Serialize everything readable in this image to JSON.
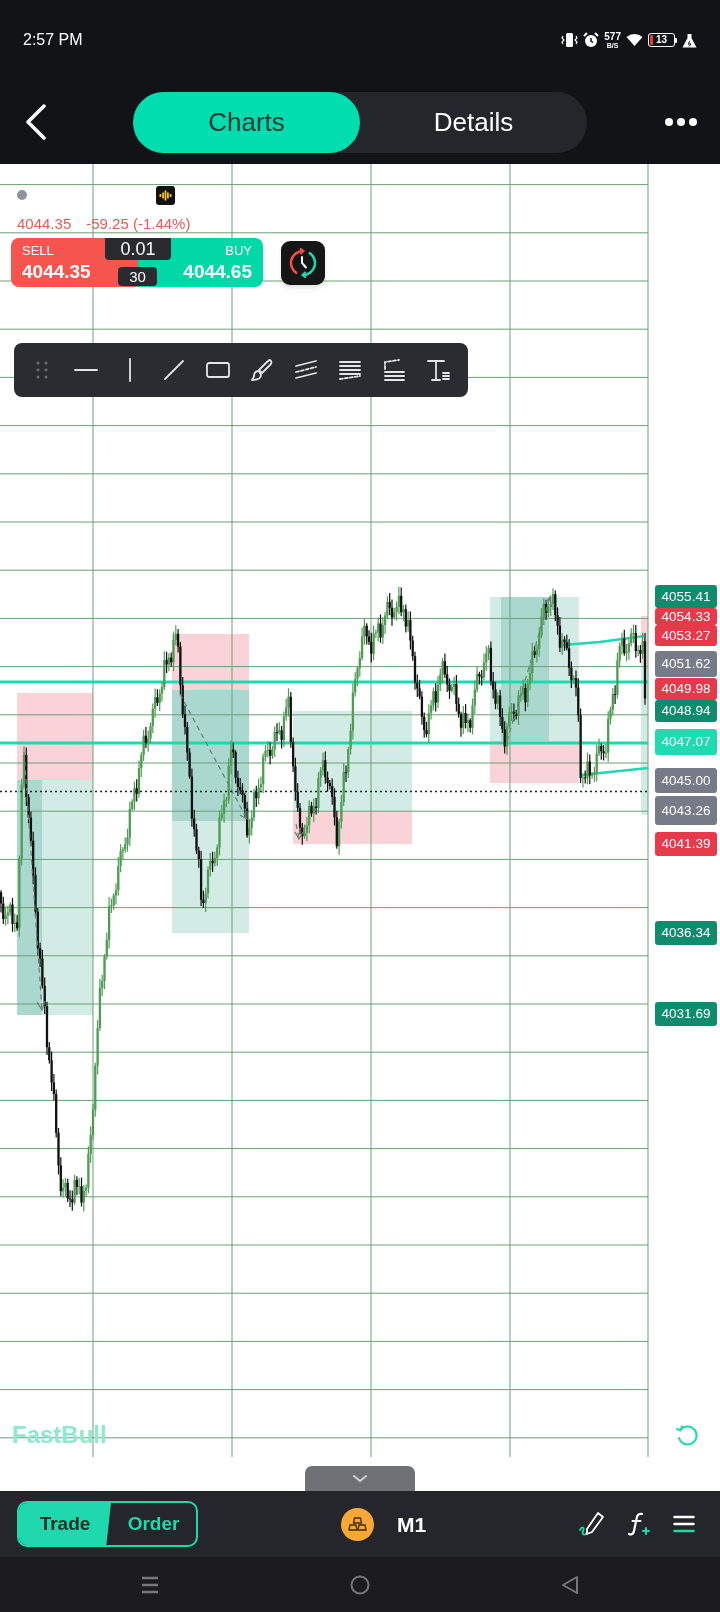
{
  "status_bar": {
    "time": "2:57 PM",
    "net_speed": "577",
    "net_speed_unit": "B/S",
    "battery": "13"
  },
  "header": {
    "tabs": [
      {
        "label": "Charts",
        "selected": true
      },
      {
        "label": "Details",
        "selected": false
      }
    ]
  },
  "quote": {
    "price": "4044.35",
    "change": "-59.25 (-1.44%)"
  },
  "trade_panel": {
    "sell": {
      "label": "SELL",
      "price": "4044.35"
    },
    "lot": "0.01",
    "spread": "30",
    "buy": {
      "label": "BUY",
      "price": "4044.65"
    }
  },
  "price_labels": [
    {
      "text": "4055.41",
      "color": "#0f8c6d"
    },
    {
      "text": "4054.33",
      "color": "#e63a4b"
    },
    {
      "text": "4053.27",
      "color": "#e63a4b"
    },
    {
      "text": "4051.62",
      "color": "#767b87"
    },
    {
      "text": "4049.98",
      "color": "#e63a4b"
    },
    {
      "text": "4048.94",
      "color": "#0f8c6d"
    },
    {
      "text": "4047.07",
      "color": "#1fdbb2"
    },
    {
      "text": "4045.00",
      "color": "#767b87"
    },
    {
      "text": "4043.26",
      "color": "#767b87"
    },
    {
      "text": "4041.39",
      "color": "#e63a4b"
    },
    {
      "text": "4036.34",
      "color": "#0f8c6d"
    },
    {
      "text": "4031.69",
      "color": "#0f8c6d"
    }
  ],
  "logo": "FastBull",
  "bottom_bar": {
    "modes": [
      {
        "label": "Trade",
        "selected": true
      },
      {
        "label": "Order",
        "selected": false
      }
    ],
    "timeframe": "M1"
  }
}
